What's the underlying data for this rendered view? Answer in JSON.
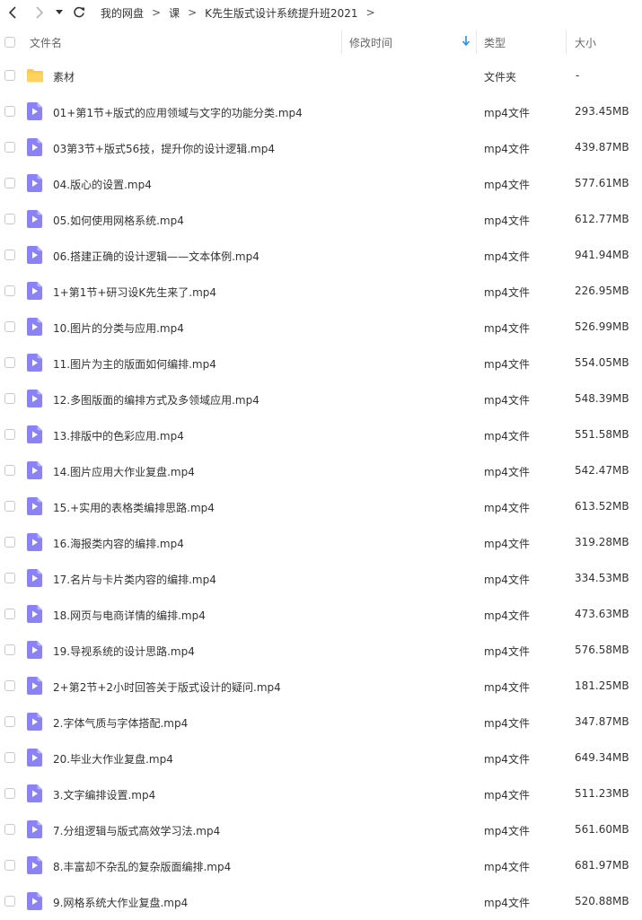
{
  "breadcrumb": [
    "我的网盘",
    "课",
    "K先生版式设计系统提升班2021"
  ],
  "breadcrumb_sep": ">",
  "columns": {
    "name": "文件名",
    "modified": "修改时间",
    "type": "类型",
    "size": "大小"
  },
  "colors": {
    "folder": "#ffc94a",
    "video_icon": "#8a82f5",
    "sort_arrow": "#2d8cf0"
  },
  "files": [
    {
      "name": "素材",
      "type": "文件夹",
      "size": "-",
      "icon": "folder-icon"
    },
    {
      "name": "01+第1节+版式的应用领域与文字的功能分类.mp4",
      "type": "mp4文件",
      "size": "293.45MB",
      "icon": "video-file-icon"
    },
    {
      "name": "03第3节+版式56技，提升你的设计逻辑.mp4",
      "type": "mp4文件",
      "size": "439.87MB",
      "icon": "video-file-icon"
    },
    {
      "name": "04.版心的设置.mp4",
      "type": "mp4文件",
      "size": "577.61MB",
      "icon": "video-file-icon"
    },
    {
      "name": "05.如何使用网格系统.mp4",
      "type": "mp4文件",
      "size": "612.77MB",
      "icon": "video-file-icon"
    },
    {
      "name": "06.搭建正确的设计逻辑——文本体例.mp4",
      "type": "mp4文件",
      "size": "941.94MB",
      "icon": "video-file-icon"
    },
    {
      "name": "1+第1节+研习设K先生来了.mp4",
      "type": "mp4文件",
      "size": "226.95MB",
      "icon": "video-file-icon"
    },
    {
      "name": "10.图片的分类与应用.mp4",
      "type": "mp4文件",
      "size": "526.99MB",
      "icon": "video-file-icon"
    },
    {
      "name": "11.图片为主的版面如何编排.mp4",
      "type": "mp4文件",
      "size": "554.05MB",
      "icon": "video-file-icon"
    },
    {
      "name": "12.多图版面的编排方式及多领域应用.mp4",
      "type": "mp4文件",
      "size": "548.39MB",
      "icon": "video-file-icon"
    },
    {
      "name": "13.排版中的色彩应用.mp4",
      "type": "mp4文件",
      "size": "551.58MB",
      "icon": "video-file-icon"
    },
    {
      "name": "14.图片应用大作业复盘.mp4",
      "type": "mp4文件",
      "size": "542.47MB",
      "icon": "video-file-icon"
    },
    {
      "name": "15.+实用的表格类编排思路.mp4",
      "type": "mp4文件",
      "size": "613.52MB",
      "icon": "video-file-icon"
    },
    {
      "name": "16.海报类内容的编排.mp4",
      "type": "mp4文件",
      "size": "319.28MB",
      "icon": "video-file-icon"
    },
    {
      "name": "17.名片与卡片类内容的编排.mp4",
      "type": "mp4文件",
      "size": "334.53MB",
      "icon": "video-file-icon"
    },
    {
      "name": "18.网页与电商详情的编排.mp4",
      "type": "mp4文件",
      "size": "473.63MB",
      "icon": "video-file-icon"
    },
    {
      "name": "19.导视系统的设计思路.mp4",
      "type": "mp4文件",
      "size": "576.58MB",
      "icon": "video-file-icon"
    },
    {
      "name": "2+第2节+2小时回答关于版式设计的疑问.mp4",
      "type": "mp4文件",
      "size": "181.25MB",
      "icon": "video-file-icon"
    },
    {
      "name": "2.字体气质与字体搭配.mp4",
      "type": "mp4文件",
      "size": "347.87MB",
      "icon": "video-file-icon"
    },
    {
      "name": "20.毕业大作业复盘.mp4",
      "type": "mp4文件",
      "size": "649.34MB",
      "icon": "video-file-icon"
    },
    {
      "name": "3.文字编排设置.mp4",
      "type": "mp4文件",
      "size": "511.23MB",
      "icon": "video-file-icon"
    },
    {
      "name": "7.分组逻辑与版式高效学习法.mp4",
      "type": "mp4文件",
      "size": "561.60MB",
      "icon": "video-file-icon"
    },
    {
      "name": "8.丰富却不杂乱的复杂版面编排.mp4",
      "type": "mp4文件",
      "size": "681.97MB",
      "icon": "video-file-icon"
    },
    {
      "name": "9.网格系统大作业复盘.mp4",
      "type": "mp4文件",
      "size": "520.88MB",
      "icon": "video-file-icon"
    }
  ]
}
